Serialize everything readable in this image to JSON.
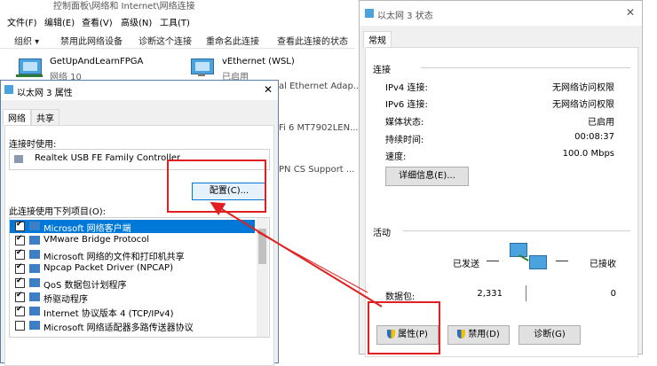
{
  "explorer": {
    "title_fragment": "控制面板\\网络和 Internet\\网络连接",
    "menu": [
      "文件(F)",
      "编辑(E)",
      "查看(V)",
      "高级(N)",
      "工具(T)"
    ],
    "commands": [
      "组织 ▾",
      "禁用此网络设备",
      "诊断这个连接",
      "重命名此连接",
      "查看此连接的状态"
    ],
    "adapters": [
      {
        "name": "GetUpAndLearnFPGA",
        "status": "网络 10"
      },
      {
        "name": "vEthernet (WSL)",
        "status": "已启用"
      }
    ],
    "partial_texts": [
      "al Ethernet Adap...",
      "Fi 6 MT7902LEN...",
      "PN CS Support ..."
    ]
  },
  "prop": {
    "title": "以太网 3 属性",
    "close": "✕",
    "tabs": [
      "网络",
      "共享"
    ],
    "connect_using_label": "连接时使用:",
    "adapter_name": "Realtek USB FE Family Controller",
    "configure_button": "配置(C)...",
    "items_label": "此连接使用下列项目(O):",
    "items": [
      {
        "label": "Microsoft 网络客户端",
        "checked": true,
        "selected": true
      },
      {
        "label": "VMware Bridge Protocol",
        "checked": true,
        "selected": false
      },
      {
        "label": "Microsoft 网络的文件和打印机共享",
        "checked": true,
        "selected": false
      },
      {
        "label": "Npcap Packet Driver (NPCAP)",
        "checked": true,
        "selected": false
      },
      {
        "label": "QoS 数据包计划程序",
        "checked": true,
        "selected": false
      },
      {
        "label": "桥驱动程序",
        "checked": true,
        "selected": false
      },
      {
        "label": "Internet 协议版本 4 (TCP/IPv4)",
        "checked": true,
        "selected": false
      },
      {
        "label": "Microsoft 网络适配器多路传送器协议",
        "checked": false,
        "selected": false
      }
    ]
  },
  "status": {
    "title": "以太网 3 状态",
    "close": "✕",
    "tab": "常规",
    "connection_section": "连接",
    "rows": [
      {
        "label": "IPv4 连接:",
        "value": "无网络访问权限"
      },
      {
        "label": "IPv6 连接:",
        "value": "无网络访问权限"
      },
      {
        "label": "媒体状态:",
        "value": "已启用"
      },
      {
        "label": "持续时间:",
        "value": "00:08:37"
      },
      {
        "label": "速度:",
        "value": "100.0 Mbps"
      }
    ],
    "details_button": "详细信息(E)...",
    "activity_section": "活动",
    "sent_label": "已发送",
    "received_label": "已接收",
    "packets_label": "数据包:",
    "packets_sent": "2,331",
    "packets_received": "0",
    "properties_button": "属性(P)",
    "disable_button": "禁用(D)",
    "diagnose_button": "诊断(G)"
  },
  "annotation_color": "#e02020"
}
